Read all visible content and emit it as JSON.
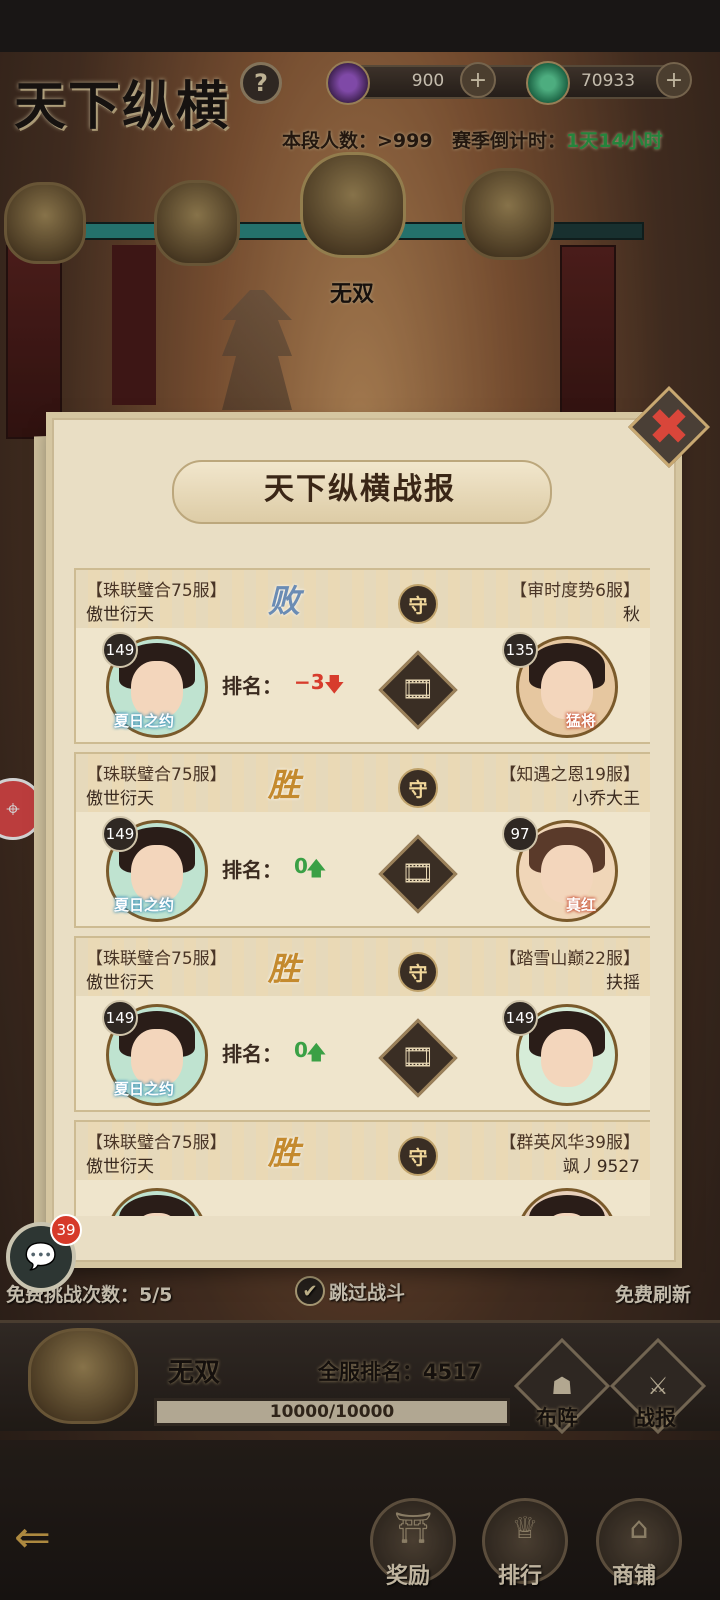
{
  "header": {
    "title": "天下纵横",
    "help_icon": "?",
    "resources": [
      {
        "name": "purple-gem",
        "value": "900",
        "color": "#7a3aa8"
      },
      {
        "name": "jade-coin",
        "value": "70933",
        "color": "#2f9a6a"
      }
    ],
    "players_label": "本段人数：>999",
    "season_label": "赛季倒计时：",
    "season_time": "1天14小时",
    "current_rank": "无双"
  },
  "modal": {
    "title": "天下纵横战报",
    "close_label": "✖"
  },
  "reports": [
    {
      "left_server": "【珠联璧合75服】",
      "left_name": "傲世衍天",
      "result": "败",
      "result_type": "lose",
      "defend": "守",
      "right_server": "【审时度势6服】",
      "right_name": "秋",
      "left_level": "149",
      "right_level": "135",
      "left_skin": "夏日之约",
      "right_skin": "猛将",
      "rank_label": "排名：",
      "rank_change": "−3",
      "direction": "down"
    },
    {
      "left_server": "【珠联璧合75服】",
      "left_name": "傲世衍天",
      "result": "胜",
      "result_type": "win",
      "defend": "守",
      "right_server": "【知遇之恩19服】",
      "right_name": "小乔大王",
      "left_level": "149",
      "right_level": "97",
      "left_skin": "夏日之约",
      "right_skin": "真红",
      "rank_label": "排名：",
      "rank_change": "0",
      "direction": "up"
    },
    {
      "left_server": "【珠联璧合75服】",
      "left_name": "傲世衍天",
      "result": "胜",
      "result_type": "win",
      "defend": "守",
      "right_server": "【踏雪山巅22服】",
      "right_name": "扶摇",
      "left_level": "149",
      "right_level": "149",
      "left_skin": "夏日之约",
      "right_skin": "",
      "rank_label": "排名：",
      "rank_change": "0",
      "direction": "up"
    },
    {
      "left_server": "【珠联璧合75服】",
      "left_name": "傲世衍天",
      "result": "胜",
      "result_type": "win",
      "defend": "守",
      "right_server": "【群英风华39服】",
      "right_name": "飒丿9527",
      "left_level": "",
      "right_level": "",
      "left_skin": "",
      "right_skin": "",
      "rank_label": "",
      "rank_change": "",
      "direction": ""
    }
  ],
  "side": {
    "chat_badge": "39",
    "free_count": "免费挑战次数：5/5",
    "skip_battle": "跳过战斗",
    "skip_checked": true,
    "free_refresh": "免费刷新"
  },
  "status": {
    "rank_name": "无双",
    "server_rank": "全服排名：4517",
    "score": "10000/10000",
    "score_fraction": 1.0,
    "formation": "布阵",
    "battle_report": "战报"
  },
  "nav": [
    {
      "label": "奖励",
      "icon": "reward-icon"
    },
    {
      "label": "排行",
      "icon": "ranking-icon"
    },
    {
      "label": "商铺",
      "icon": "shop-icon"
    }
  ]
}
